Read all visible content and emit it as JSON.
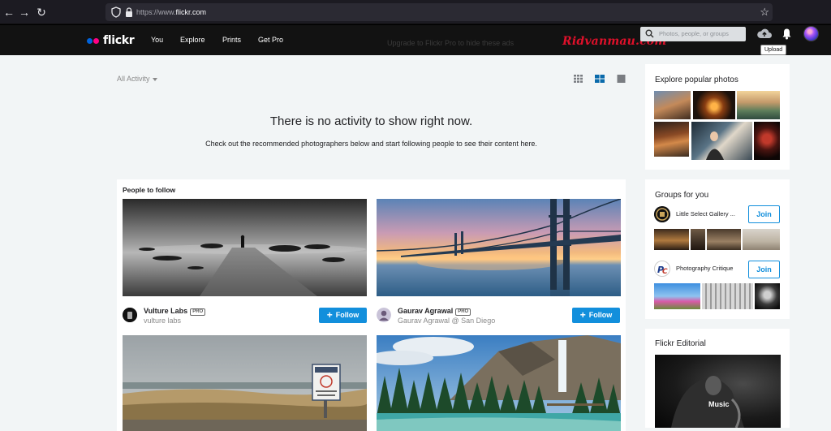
{
  "browser": {
    "url_dim": "https://www.",
    "url_main": "flickr.com"
  },
  "nav": {
    "logo": "flickr",
    "logo_colors": [
      "#0063dc",
      "#ff0084"
    ],
    "links": [
      "You",
      "Explore",
      "Prints",
      "Get Pro"
    ],
    "upgrade_text": "Upgrade to Flickr Pro to hide these ads",
    "watermark": "Ridvanmau.com",
    "search_placeholder": "Photos, people, or groups",
    "upload_tooltip": "Upload",
    "icons": [
      "search-icon",
      "upload-cloud-icon",
      "bell-icon"
    ]
  },
  "feed": {
    "filter_label": "All Activity",
    "view_options": [
      "grid-view-icon",
      "list-view-icon",
      "single-view-icon"
    ],
    "empty_title": "There is no activity to show right now.",
    "empty_subtitle": "Check out the recommended photographers below and start following people to see their content here."
  },
  "people_to_follow": {
    "title": "People to follow",
    "people": [
      {
        "name": "Vulture Labs",
        "badge": "PRO",
        "subtitle": "vulture labs",
        "follow_label": "Follow"
      },
      {
        "name": "Gaurav Agrawal",
        "badge": "PRO",
        "subtitle": "Gaurav Agrawal @ San Diego",
        "follow_label": "Follow"
      }
    ]
  },
  "sidebar": {
    "explore_title": "Explore popular photos",
    "groups_title": "Groups for you",
    "groups": [
      {
        "name": "Little Select Gallery ...",
        "join_label": "Join"
      },
      {
        "name": "Photography Critique",
        "join_label": "Join"
      }
    ],
    "editorial_title": "Flickr Editorial",
    "editorial_caption": "Music"
  },
  "colors": {
    "accent": "#128fdc",
    "nav_bg": "#121212",
    "page_bg": "#f2f5f6"
  }
}
